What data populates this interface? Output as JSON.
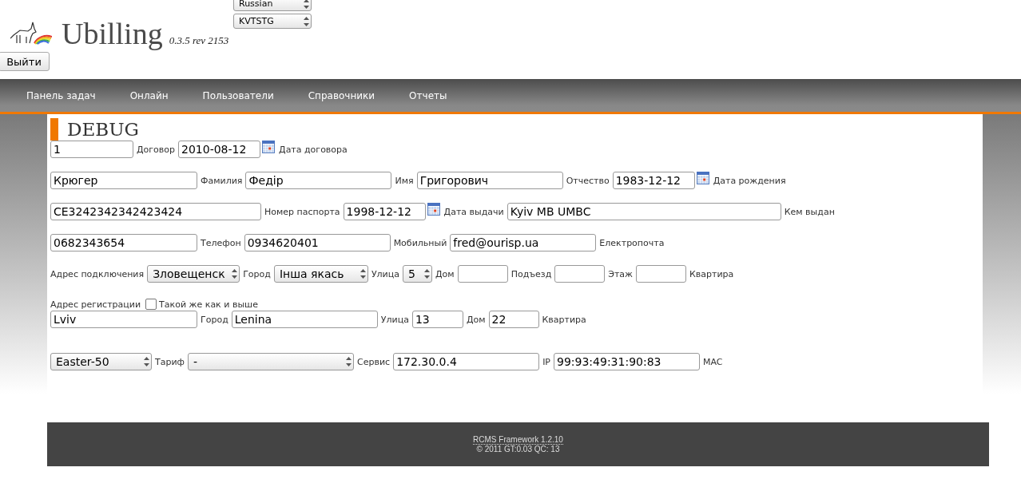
{
  "header": {
    "title": "Ubilling",
    "version": "0.3.5 rev 2153",
    "selects": [
      "Russian",
      "KVTSTG"
    ],
    "logout": "Выйти"
  },
  "nav": [
    {
      "label": "Панель задач"
    },
    {
      "label": "Онлайн"
    },
    {
      "label": "Пользователи"
    },
    {
      "label": "Справочники"
    },
    {
      "label": "Отчеты"
    }
  ],
  "section_title": "DEBUG",
  "form_rows": [
    [
      {
        "kind": "input",
        "value": "1"
      },
      {
        "kind": "label",
        "text": "Договор"
      },
      {
        "kind": "input",
        "value": "2010-08-12"
      },
      {
        "kind": "calendar"
      },
      {
        "kind": "label",
        "text": "Дата договора"
      }
    ],
    [
      {
        "kind": "input",
        "value": "Крюгер"
      },
      {
        "kind": "label",
        "text": "Фамилия"
      },
      {
        "kind": "input",
        "value": "Федір"
      },
      {
        "kind": "label",
        "text": "Имя"
      },
      {
        "kind": "input",
        "value": "Григорович"
      },
      {
        "kind": "label",
        "text": "Отчество"
      },
      {
        "kind": "input",
        "value": "1983-12-12"
      },
      {
        "kind": "calendar"
      },
      {
        "kind": "label",
        "text": "Дата рождения"
      }
    ],
    [
      {
        "kind": "input",
        "value": "CE3242342342423424"
      },
      {
        "kind": "label",
        "text": "Номер паспорта"
      },
      {
        "kind": "input",
        "value": "1998-12-12"
      },
      {
        "kind": "calendar"
      },
      {
        "kind": "label",
        "text": "Дата выдачи"
      },
      {
        "kind": "input",
        "value": "Kyiv MB UMBC"
      },
      {
        "kind": "label",
        "text": "Кем выдан"
      }
    ],
    [
      {
        "kind": "input",
        "value": "0682343654"
      },
      {
        "kind": "label",
        "text": "Телефон"
      },
      {
        "kind": "input",
        "value": "0934620401"
      },
      {
        "kind": "label",
        "text": "Мобильный"
      },
      {
        "kind": "input",
        "value": "fred@ourisp.ua"
      },
      {
        "kind": "label",
        "text": "Електропочта"
      }
    ],
    [
      {
        "kind": "label",
        "text": "Адрес подключения"
      },
      {
        "kind": "select",
        "value": "Зловещенск"
      },
      {
        "kind": "label",
        "text": "Город"
      },
      {
        "kind": "select",
        "value": "Інша якась"
      },
      {
        "kind": "label",
        "text": "Улица"
      },
      {
        "kind": "select",
        "value": "5"
      },
      {
        "kind": "label",
        "text": "Дом"
      },
      {
        "kind": "input"
      },
      {
        "kind": "label",
        "text": "Подъезд"
      },
      {
        "kind": "input"
      },
      {
        "kind": "label",
        "text": "Этаж"
      },
      {
        "kind": "input"
      },
      {
        "kind": "label",
        "text": "Квартира"
      }
    ],
    [
      {
        "kind": "label",
        "text": "Адрес регистрации"
      },
      {
        "kind": "checkbox",
        "checked": false,
        "label": "Такой же как и выше"
      }
    ],
    [
      {
        "kind": "input",
        "value": "Lviv"
      },
      {
        "kind": "label",
        "text": "Город"
      },
      {
        "kind": "input",
        "value": "Lenina"
      },
      {
        "kind": "label",
        "text": "Улица"
      },
      {
        "kind": "input",
        "value": "13"
      },
      {
        "kind": "label",
        "text": "Дом"
      },
      {
        "kind": "input",
        "value": "22"
      },
      {
        "kind": "label",
        "text": "Квартира"
      }
    ],
    [
      {
        "kind": "select",
        "value": "Easter-50"
      },
      {
        "kind": "label",
        "text": "Тариф"
      },
      {
        "kind": "select",
        "value": "-"
      },
      {
        "kind": "label",
        "text": "Сервис"
      },
      {
        "kind": "input",
        "value": "172.30.0.4"
      },
      {
        "kind": "label",
        "text": "IP"
      },
      {
        "kind": "input",
        "value": "99:93:49:31:90:83"
      },
      {
        "kind": "label",
        "text": "MAC"
      }
    ]
  ],
  "footer": {
    "link": "RCMS Framework 1.2.10",
    "text": "© 2011 GT:0.03 QC: 13"
  }
}
